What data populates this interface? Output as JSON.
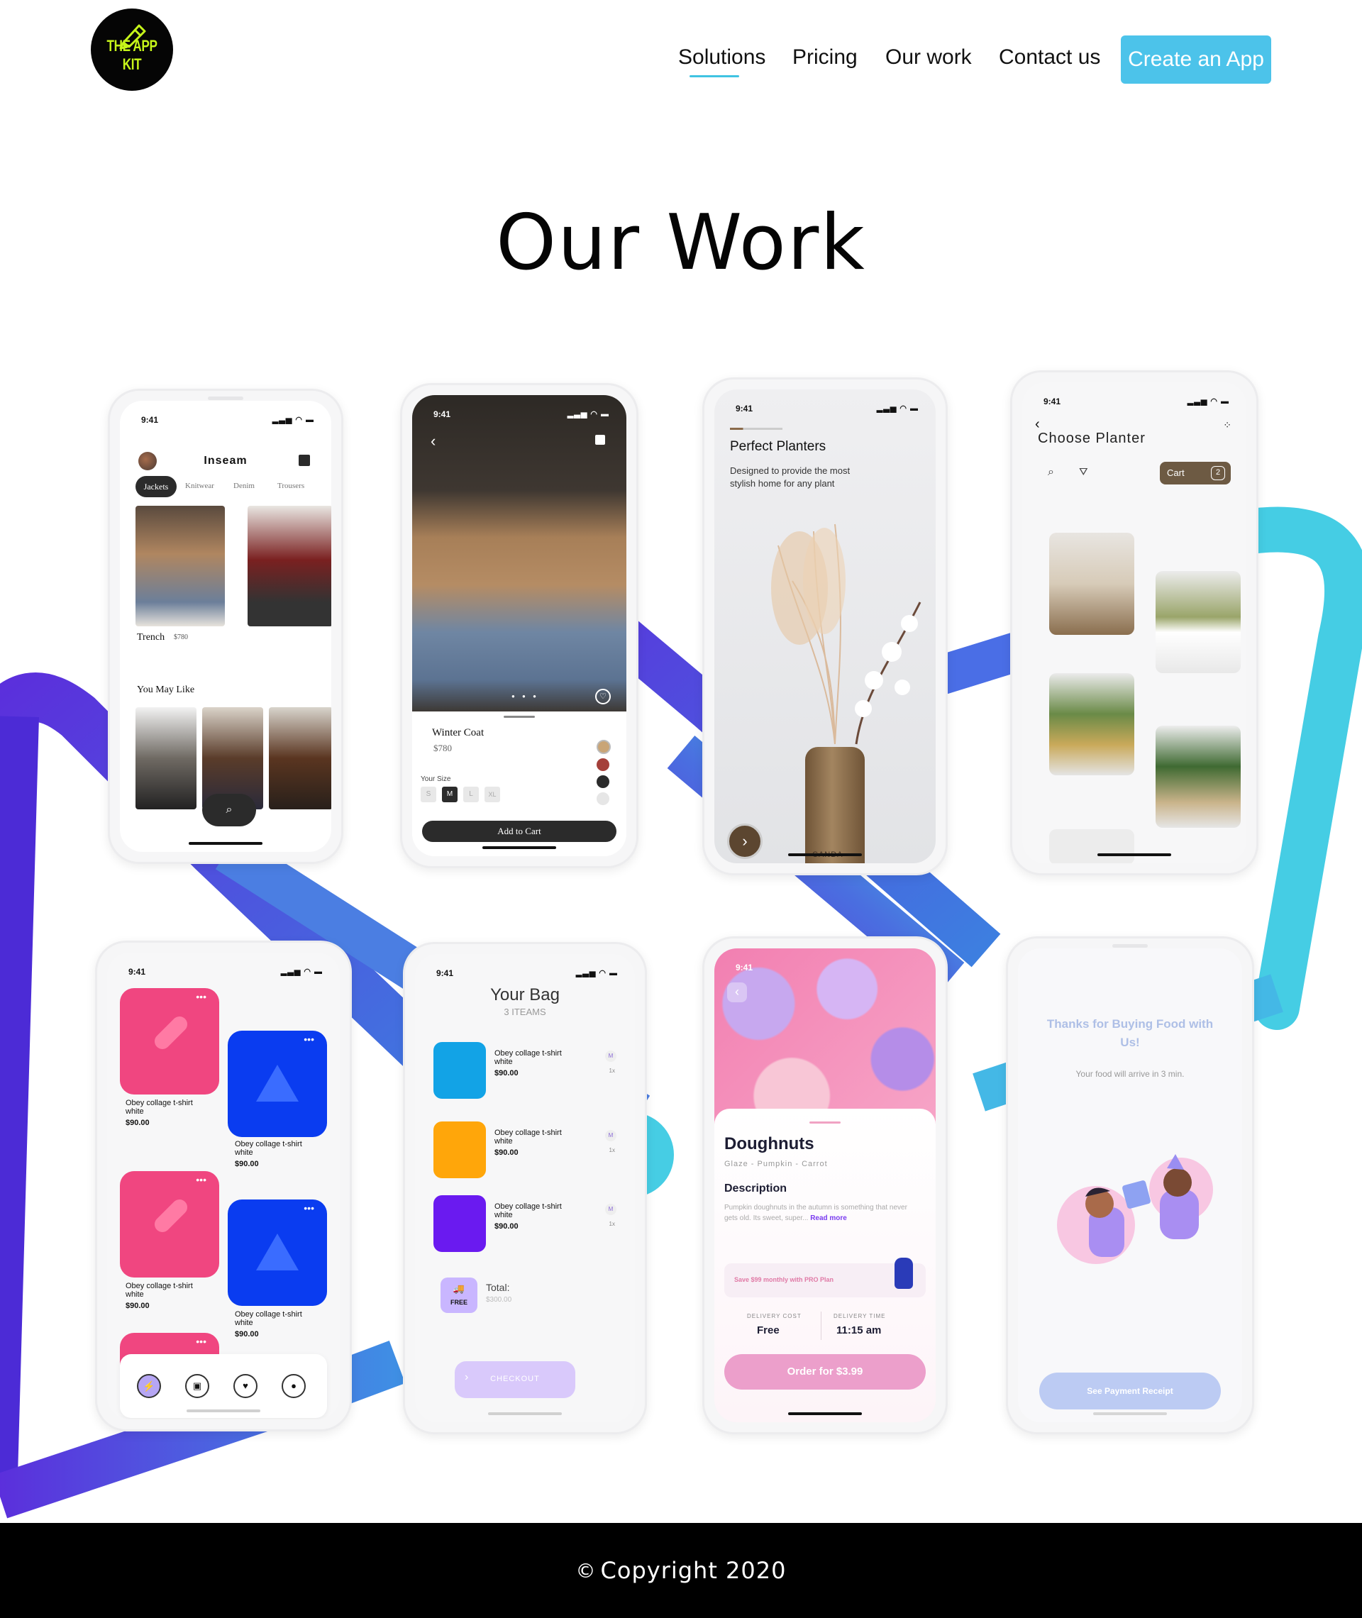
{
  "brand": {
    "logo_text": "THE APP KIT"
  },
  "nav": {
    "items": [
      {
        "label": "Solutions"
      },
      {
        "label": "Pricing"
      },
      {
        "label": "Our work"
      },
      {
        "label": "Contact us"
      }
    ],
    "cta_label": "Create an App"
  },
  "page_title": "Our Work",
  "phones": {
    "inseam": {
      "time": "9:41",
      "title": "Inseam",
      "tabs": [
        "Jackets",
        "Knitwear",
        "Denim",
        "Trousers"
      ],
      "product_name": "Trench",
      "product_price": "$780",
      "section": "You May Like"
    },
    "coat": {
      "time": "9:41",
      "name": "Winter Coat",
      "price": "$780",
      "size_label": "Your Size",
      "sizes": [
        "S",
        "M",
        "L",
        "XL"
      ],
      "button": "Add to Cart",
      "swatches": [
        "#c9a577",
        "#a4403a",
        "#2b2b2b",
        "#e6e6e6"
      ]
    },
    "planters": {
      "time": "9:41",
      "title": "Perfect Planters",
      "desc": "Designed to provide the most stylish home for any plant",
      "vase_text": "CANDA"
    },
    "choose": {
      "time": "9:41",
      "title": "Choose Planter",
      "cart_label": "Cart",
      "cart_count": "2"
    },
    "grid": {
      "time": "9:41",
      "cards": [
        {
          "name": "Obey collage t-shirt white",
          "price": "$90.00"
        },
        {
          "name": "Obey collage t-shirt white",
          "price": "$90.00"
        },
        {
          "name": "Obey collage t-shirt white",
          "price": "$90.00"
        },
        {
          "name": "Obey collage t-shirt white",
          "price": "$90.00"
        }
      ]
    },
    "bag": {
      "time": "9:41",
      "title": "Your Bag",
      "subtitle": "3 ITEAMS",
      "items": [
        {
          "name": "Obey collage t-shirt white",
          "price": "$90.00",
          "size": "M",
          "qty": "1x"
        },
        {
          "name": "Obey collage t-shirt white",
          "price": "$90.00",
          "size": "M",
          "qty": "1x"
        },
        {
          "name": "Obey collage t-shirt white",
          "price": "$90.00",
          "size": "M",
          "qty": "1x"
        }
      ],
      "free_label": "FREE",
      "total_label": "Total:",
      "total_value": "$300.00",
      "checkout": "CHECKOUT"
    },
    "donut": {
      "time": "9:41",
      "title": "Doughnuts",
      "subtitle": "Glaze - Pumpkin - Carrot",
      "desc_title": "Description",
      "desc": "Pumpkin doughnuts in the autumn is something that never gets old. Its sweet, super...",
      "read_more": "Read more",
      "promo": "Save $99 monthly with PRO Plan",
      "cost_label": "DELIVERY COST",
      "cost_value": "Free",
      "time_label": "DELIVERY TIME",
      "time_value": "11:15 am",
      "order": "Order for $3.99"
    },
    "thanks": {
      "title": "Thanks for Buying Food with Us!",
      "subtitle": "Your food will arrive in 3 min.",
      "button": "See Payment Receipt"
    }
  },
  "footer": {
    "copyright": "Copyright 2020"
  }
}
